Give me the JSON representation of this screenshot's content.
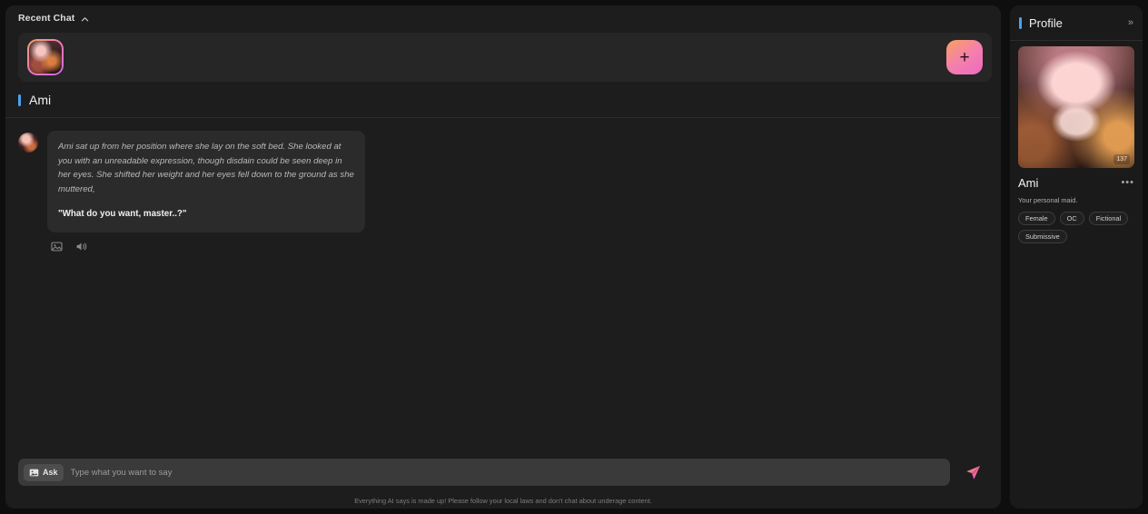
{
  "recent": {
    "label": "Recent Chat",
    "chevron_icon": "chevron-up-icon",
    "thumb_icon": "character-thumbnail",
    "add_label": "+"
  },
  "conversation": {
    "character_name": "Ami",
    "accent_color": "#4aa3f0",
    "message": {
      "narration": "Ami sat up from her position where she lay on the soft bed. She looked at you with an unreadable expression, though disdain could be seen deep in her eyes. She shifted her weight and her eyes fell down to the ground as she muttered,",
      "quote": "\"What do you want, master..?\"",
      "actions": [
        "image-icon",
        "speaker-icon"
      ]
    }
  },
  "composer": {
    "ask_label": "Ask",
    "ask_icon": "image-icon",
    "placeholder": "Type what you want to say",
    "value": "",
    "send_icon": "send-icon"
  },
  "disclaimer": "Everything AI says is made up! Please follow your local laws and don't chat about underage content.",
  "profile": {
    "title": "Profile",
    "collapse_label": "»",
    "hero_badge": "137",
    "name": "Ami",
    "more_label": "•••",
    "description": "Your personal maid.",
    "tags": [
      "Female",
      "OC",
      "Fictional",
      "Submissive"
    ]
  },
  "colors": {
    "page_bg": "#0e0e0e",
    "panel_bg": "#1d1d1d",
    "accent_blue": "#4aa3f0",
    "gradient_pink": "#f47fae",
    "gradient_orange": "#f9a061"
  }
}
